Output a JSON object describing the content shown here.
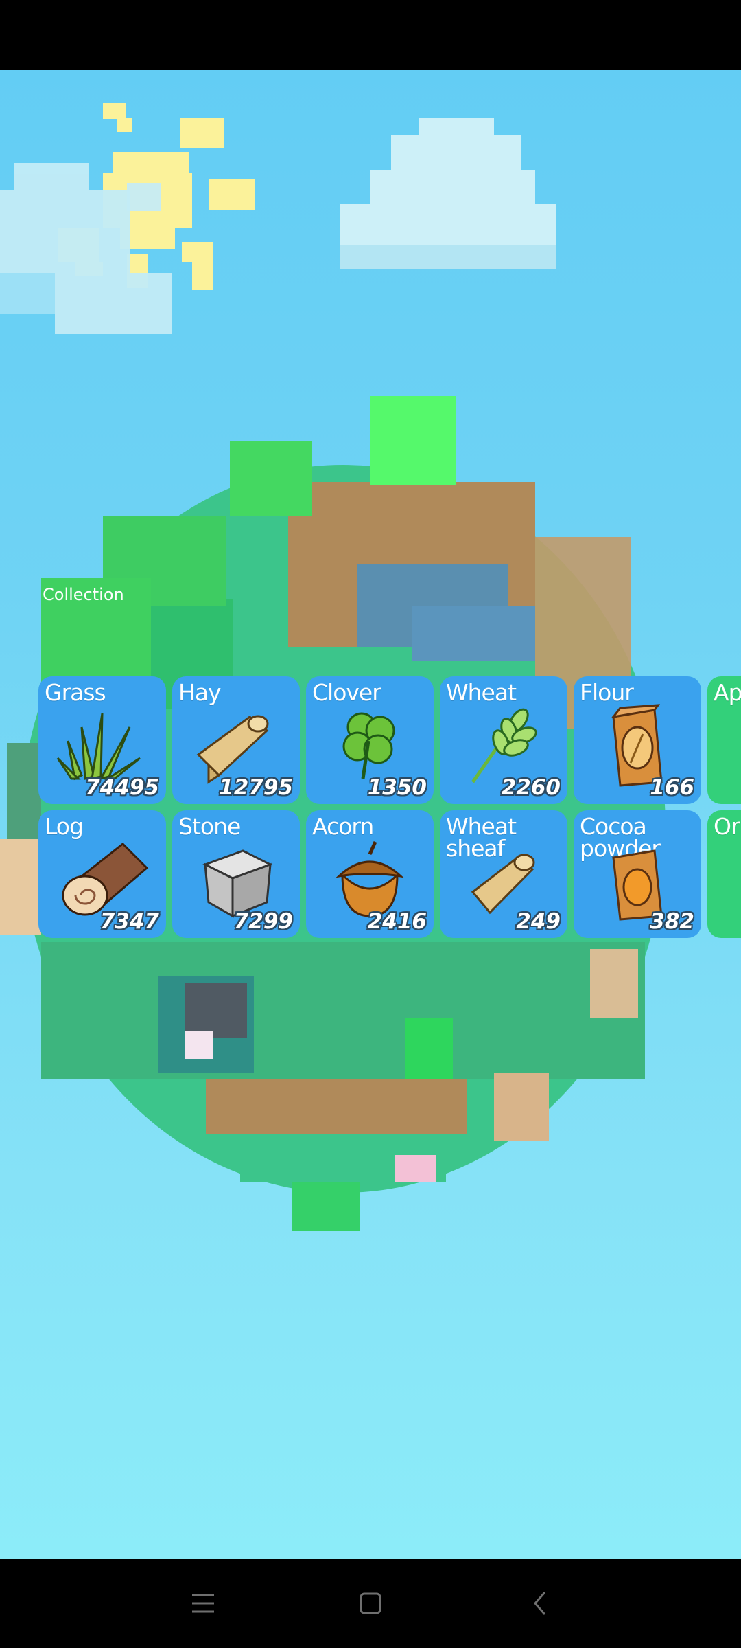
{
  "collection": {
    "label": "Collection",
    "rows": [
      [
        {
          "name": "Grass",
          "count": "74495",
          "icon": "grass-icon",
          "color": "#3aa2ee"
        },
        {
          "name": "Hay",
          "count": "12795",
          "icon": "hay-icon",
          "color": "#3aa2ee"
        },
        {
          "name": "Clover",
          "count": "1350",
          "icon": "clover-icon",
          "color": "#3aa2ee"
        },
        {
          "name": "Wheat",
          "count": "2260",
          "icon": "wheat-icon",
          "color": "#3aa2ee"
        },
        {
          "name": "Flour",
          "count": "166",
          "icon": "flour-bag-icon",
          "color": "#3aa2ee"
        },
        {
          "name": "Ap",
          "count": "",
          "icon": "apple-icon",
          "color": "#33d07a"
        }
      ],
      [
        {
          "name": "Log",
          "count": "7347",
          "icon": "log-icon",
          "color": "#3aa2ee"
        },
        {
          "name": "Stone",
          "count": "7299",
          "icon": "stone-icon",
          "color": "#3aa2ee"
        },
        {
          "name": "Acorn",
          "count": "2416",
          "icon": "acorn-icon",
          "color": "#3aa2ee"
        },
        {
          "name": "Wheat sheaf",
          "count": "249",
          "icon": "wheat-sheaf-icon",
          "color": "#3aa2ee"
        },
        {
          "name": "Cocoa powder",
          "count": "382",
          "icon": "cocoa-powder-icon",
          "color": "#3aa2ee"
        },
        {
          "name": "Or",
          "count": "",
          "icon": "orange-icon",
          "color": "#33d07a"
        }
      ]
    ]
  },
  "navbar": {
    "buttons": [
      {
        "icon": "menu-icon"
      },
      {
        "icon": "home-icon"
      },
      {
        "icon": "back-icon"
      }
    ]
  }
}
